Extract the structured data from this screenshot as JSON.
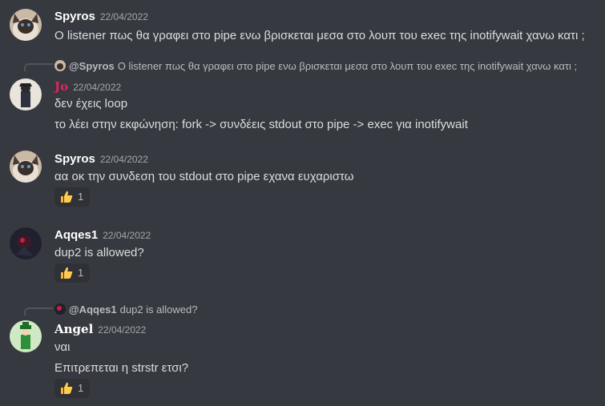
{
  "messages": [
    {
      "author": "Spyros",
      "timestamp": "22/04/2022",
      "lines": [
        "Ο listener πως θα γραφει στο pipe ενω βρισκεται μεσα στο λουπ του exec της inotifywait χανω κατι ;"
      ]
    },
    {
      "reply_to": {
        "author": "@Spyros",
        "text": "Ο listener πως θα γραφει στο pipe ενω βρισκεται μεσα στο λουπ του exec της inotifywait χανω κατι ;"
      },
      "author": "Jo",
      "author_color": "#e0245e",
      "timestamp": "22/04/2022",
      "lines": [
        "δεν έχεις loop",
        "το λέει στην εκφώνηση: fork -> συνδέεις stdout στο pipe -> exec για inotifywait"
      ]
    },
    {
      "author": "Spyros",
      "timestamp": "22/04/2022",
      "lines": [
        "αα οκ την συνδεση του stdout στο pipe εχανα ευχαριστω"
      ],
      "reaction": {
        "emoji": "thumbs-up",
        "count": "1"
      }
    },
    {
      "author": "Aqqes1",
      "timestamp": "22/04/2022",
      "lines": [
        "dup2 is allowed?"
      ],
      "reaction": {
        "emoji": "thumbs-up",
        "count": "1"
      }
    },
    {
      "reply_to": {
        "author": "@Aqqes1",
        "text": "dup2 is allowed?"
      },
      "author": "Angel",
      "timestamp": "22/04/2022",
      "lines": [
        "ναι",
        "Επιτρεπεται η strstr ετσι?"
      ],
      "reaction": {
        "emoji": "thumbs-up",
        "count": "1"
      }
    }
  ],
  "colors": {
    "background": "#36393f",
    "text": "#dcddde",
    "timestamp": "#a3a6aa",
    "reaction_bg": "#2f3136",
    "jo_name": "#e0245e"
  }
}
